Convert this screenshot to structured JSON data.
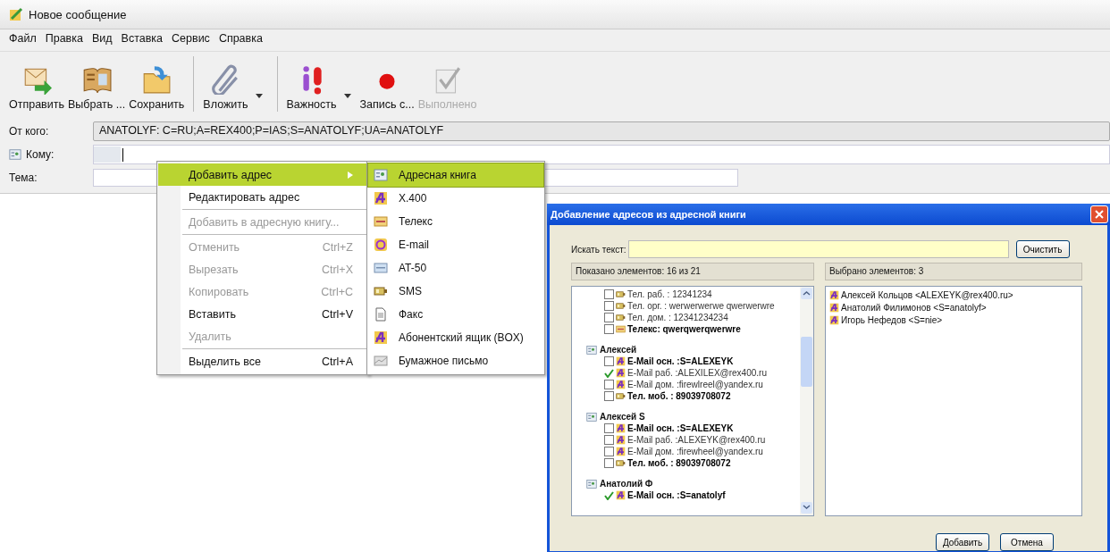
{
  "window": {
    "title": "Новое сообщение"
  },
  "menu_bar": [
    "Файл",
    "Правка",
    "Вид",
    "Вставка",
    "Сервис",
    "Справка"
  ],
  "toolbar": [
    {
      "kind": "send",
      "label": "Отправить",
      "disabled": false
    },
    {
      "kind": "book",
      "label": "Выбрать ...",
      "disabled": false
    },
    {
      "kind": "save",
      "label": "Сохранить",
      "disabled": false
    },
    {
      "kind": "separator"
    },
    {
      "kind": "attach",
      "label": "Вложить",
      "disabled": false
    },
    {
      "kind": "dropdown"
    },
    {
      "kind": "separator"
    },
    {
      "kind": "importance",
      "label": "Важность",
      "disabled": false
    },
    {
      "kind": "dropdown"
    },
    {
      "kind": "record",
      "label": "Запись с...",
      "disabled": false
    },
    {
      "kind": "done",
      "label": "Выполнено",
      "disabled": true
    }
  ],
  "fields": [
    {
      "kind": "from",
      "label": "От кого:",
      "value": "ANATOLYF: C=RU;A=REX400;P=IAS;S=ANATOLYF;UA=ANATOLYF"
    },
    {
      "kind": "to",
      "label": "Кому:"
    },
    {
      "kind": "subject",
      "label": "Тема:"
    }
  ],
  "context_menu": {
    "groups": [
      [
        {
          "label": "Добавить адрес",
          "disabled": false,
          "submenu": true,
          "selected": true
        },
        {
          "label": "Редактировать адрес",
          "disabled": false,
          "submenu": false,
          "selected": false
        }
      ],
      [
        {
          "label": "Добавить в адресную книгу...",
          "disabled": true,
          "submenu": false,
          "selected": false
        }
      ],
      [
        {
          "label": "Отменить",
          "shortcut": "Ctrl+Z",
          "disabled": true,
          "submenu": false,
          "selected": false
        },
        {
          "label": "Вырезать",
          "shortcut": "Ctrl+X",
          "disabled": true,
          "submenu": false,
          "selected": false
        },
        {
          "label": "Копировать",
          "shortcut": "Ctrl+C",
          "disabled": true,
          "submenu": false,
          "selected": false
        },
        {
          "label": "Вставить",
          "shortcut": "Ctrl+V",
          "disabled": false,
          "submenu": false,
          "selected": false
        },
        {
          "label": "Удалить",
          "disabled": true,
          "submenu": false,
          "selected": false
        }
      ],
      [
        {
          "label": "Выделить все",
          "shortcut": "Ctrl+A",
          "disabled": false,
          "submenu": false,
          "selected": false
        }
      ]
    ]
  },
  "submenu": [
    {
      "kind": "addressbook",
      "label": "Адресная книга",
      "selected": true
    },
    {
      "kind": "x400",
      "label": "X.400",
      "selected": false
    },
    {
      "kind": "telex",
      "label": "Телекс",
      "selected": false
    },
    {
      "kind": "email",
      "label": "E-mail",
      "selected": false
    },
    {
      "kind": "at50",
      "label": "AT-50",
      "selected": false
    },
    {
      "kind": "sms",
      "label": "SMS",
      "selected": false
    },
    {
      "kind": "fax",
      "label": "Факс",
      "selected": false
    },
    {
      "kind": "x400",
      "label": "Абонентский ящик (BOX)",
      "selected": false
    },
    {
      "kind": "paper",
      "label": "Бумажное письмо",
      "selected": false
    }
  ],
  "dialog": {
    "title": "Добавление адресов из адресной книги",
    "search": {
      "label": "Искать текст:",
      "button": "Очистить"
    },
    "shown_status": "Показано элементов: 16 из 21",
    "selected_status": "Выбрано элементов: 3",
    "tree": [
      {
        "children": [
          {
            "kind": "phone",
            "label": "Тел. раб. : 12341234",
            "checked": false,
            "primary": false
          },
          {
            "kind": "phone",
            "label": "Тел. орг. : werwerwerwe qwerwerwre",
            "checked": false,
            "primary": false
          },
          {
            "kind": "phone",
            "label": "Тел. дом. : 12341234234",
            "checked": false,
            "primary": false
          },
          {
            "kind": "telex",
            "label": "Телекс: qwerqwerqwerwre",
            "checked": false,
            "primary": true
          }
        ]
      },
      {
        "name": "Алексей",
        "children": [
          {
            "kind": "x400",
            "label": "E-Mail осн. :S=ALEXEYK",
            "checked": false,
            "primary": true
          },
          {
            "kind": "x400",
            "label": "E-Mail раб. :ALEXILEX@rex400.ru",
            "checked": true,
            "primary": false
          },
          {
            "kind": "x400",
            "label": "E-Mail дом. :firewlreel@yandex.ru",
            "checked": false,
            "primary": false
          },
          {
            "kind": "phone",
            "label": "Тел. моб. : 89039708072",
            "checked": false,
            "primary": true
          }
        ]
      },
      {
        "name": "Алексей  S",
        "children": [
          {
            "kind": "x400",
            "label": "E-Mail осн. :S=ALEXEYK",
            "checked": false,
            "primary": true
          },
          {
            "kind": "x400",
            "label": "E-Mail раб. :ALEXEYK@rex400.ru",
            "checked": false,
            "primary": false
          },
          {
            "kind": "x400",
            "label": "E-Mail дом. :firewheel@yandex.ru",
            "checked": false,
            "primary": false
          },
          {
            "kind": "phone",
            "label": "Тел. моб. : 89039708072",
            "checked": false,
            "primary": true
          }
        ]
      },
      {
        "name": "Анатолий Ф",
        "children": [
          {
            "kind": "x400",
            "label": "E-Mail осн. :S=anatolyf",
            "checked": true,
            "primary": true
          }
        ]
      }
    ],
    "selected": [
      "Алексей Кольцов <ALEXEYK@rex400.ru>",
      "Анатолий Филимонов <S=anatolyf>",
      "Игорь Нефедов <S=nie>"
    ],
    "buttons": [
      "Добавить",
      "Отмена"
    ]
  }
}
